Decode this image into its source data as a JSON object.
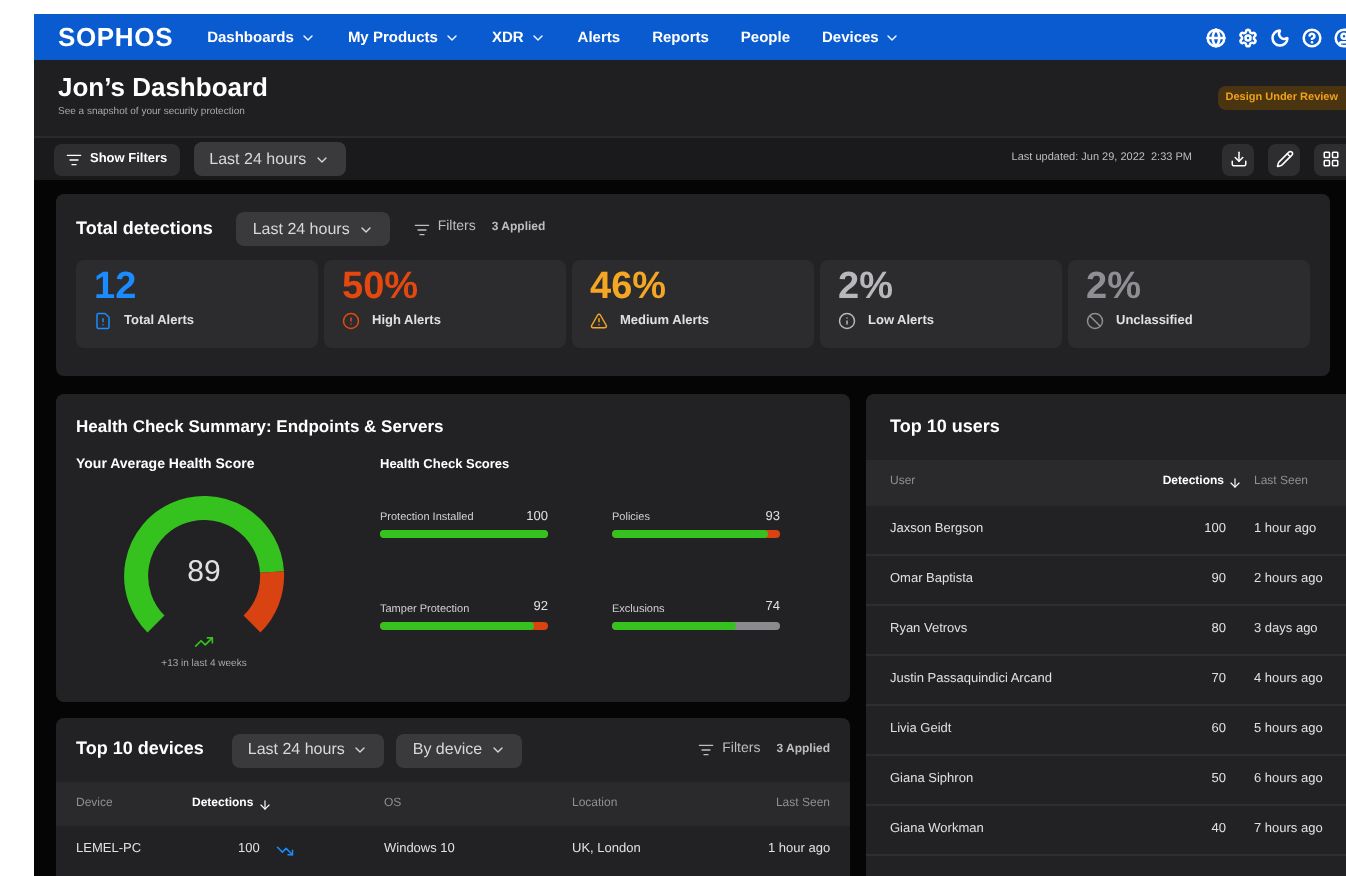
{
  "nav": {
    "logo": "SOPHOS",
    "items": [
      {
        "label": "Dashboards",
        "has_menu": true
      },
      {
        "label": "My Products",
        "has_menu": true
      },
      {
        "label": "XDR",
        "has_menu": true
      },
      {
        "label": "Alerts",
        "has_menu": false
      },
      {
        "label": "Reports",
        "has_menu": false
      },
      {
        "label": "People",
        "has_menu": false
      },
      {
        "label": "Devices",
        "has_menu": true
      }
    ]
  },
  "header": {
    "title": "Jon’s Dashboard",
    "subtitle": "See a snapshot of your security protection",
    "badge": "Design Under Review"
  },
  "toolbar": {
    "filters_button": "Show Filters",
    "range": "Last 24 hours",
    "last_updated": "Last updated: Jun 29, 2022  2:33 PM"
  },
  "total_detections": {
    "title": "Total detections",
    "range": "Last 24 hours",
    "filters": "Filters",
    "applied": "3 Applied",
    "stats": [
      {
        "kind": "total",
        "value": "12",
        "label": "Total Alerts",
        "color": "#1a8cff"
      },
      {
        "kind": "high",
        "value": "50%",
        "label": "High Alerts",
        "color": "#e5480f"
      },
      {
        "kind": "medium",
        "value": "46%",
        "label": "Medium Alerts",
        "color": "#f5a623"
      },
      {
        "kind": "low",
        "value": "2%",
        "label": "Low Alerts",
        "color": "#b8b8bc"
      },
      {
        "kind": "unclassified",
        "value": "2%",
        "label": "Unclassified",
        "color": "#8e8e93"
      }
    ]
  },
  "health": {
    "title": "Health Check Summary: Endpoints & Servers",
    "average_title": "Your Average Health Score",
    "score": "89",
    "trend": "+13 in last 4 weeks",
    "scores_title": "Health Check Scores",
    "scores": [
      {
        "label": "Protection Installed",
        "value": "100",
        "level": 1.0
      },
      {
        "label": "Policies",
        "value": "93",
        "level": 0.93,
        "color": "#d94312"
      },
      {
        "label": "Tamper Protection",
        "value": "92",
        "level": 0.92,
        "color": "#d94312"
      },
      {
        "label": "Exclusions",
        "value": "74",
        "level": 0.74,
        "color": "#8a8a8f"
      }
    ]
  },
  "devices": {
    "title": "Top 10 devices",
    "range": "Last 24 hours",
    "grouping": "By device",
    "filters": "Filters",
    "applied": "3 Applied",
    "columns": [
      {
        "label": "Device",
        "sorted": false
      },
      {
        "label": "Detections",
        "sorted": true
      },
      {
        "label": "OS",
        "sorted": false
      },
      {
        "label": "Location",
        "sorted": false
      },
      {
        "label": "Last Seen",
        "sorted": false
      }
    ],
    "rows": [
      {
        "device": "LEMEL-PC",
        "detections": "100",
        "os": "Windows 10",
        "location": "UK, London",
        "last_seen": "1 hour ago"
      }
    ]
  },
  "users": {
    "title": "Top 10 users",
    "columns": [
      {
        "label": "User",
        "sorted": false
      },
      {
        "label": "Detections",
        "sorted": true
      },
      {
        "label": "Last Seen",
        "sorted": false
      }
    ],
    "rows": [
      {
        "user": "Jaxson Bergson",
        "detections": "100",
        "last_seen": "1 hour ago"
      },
      {
        "user": "Omar Baptista",
        "detections": "90",
        "last_seen": "2 hours ago"
      },
      {
        "user": "Ryan Vetrovs",
        "detections": "80",
        "last_seen": "3 days ago"
      },
      {
        "user": "Justin Passaquindici Arcand",
        "detections": "70",
        "last_seen": "4 hours ago"
      },
      {
        "user": "Livia Geidt",
        "detections": "60",
        "last_seen": "5 hours ago"
      },
      {
        "user": "Giana Siphron",
        "detections": "50",
        "last_seen": "6 hours ago"
      },
      {
        "user": "Giana Workman",
        "detections": "40",
        "last_seen": "7 hours ago"
      }
    ]
  }
}
